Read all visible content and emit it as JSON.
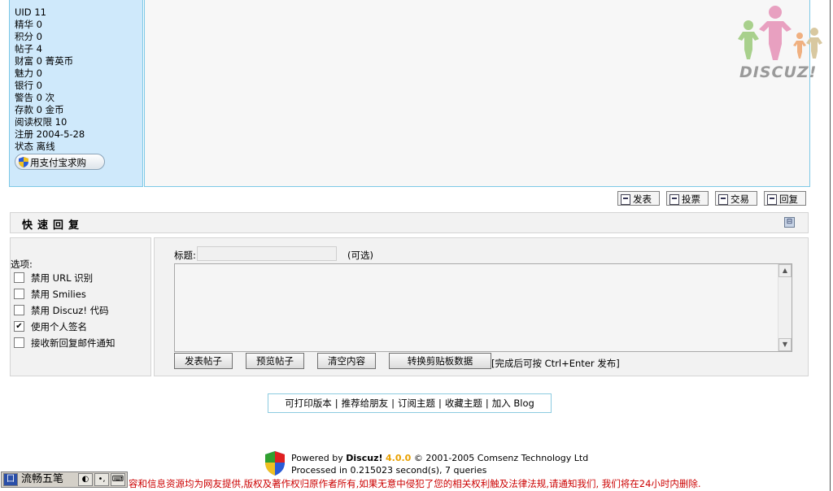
{
  "profile": {
    "lines": [
      "UID 11",
      "精华 0",
      "积分 0",
      "帖子 4",
      "财富 0 菁英币",
      "魅力 0",
      "银行 0",
      "警告 0 次",
      "存款 0 金币",
      "阅读权限 10",
      "注册 2004-5-28",
      "状态 离线"
    ],
    "alipay_button": "用支付宝求购"
  },
  "logo": {
    "text": "DISCUZ!"
  },
  "actions": {
    "post": "发表",
    "poll": "投票",
    "trade": "交易",
    "reply": "回复"
  },
  "quick_reply": {
    "title": "快速回复",
    "options_label": "选项:",
    "options": [
      {
        "label": "禁用 URL 识别",
        "checked": false
      },
      {
        "label": "禁用 Smilies",
        "checked": false
      },
      {
        "label": "禁用 Discuz! 代码",
        "checked": false
      },
      {
        "label": "使用个人签名",
        "checked": true
      },
      {
        "label": "接收新回复邮件通知",
        "checked": false
      }
    ],
    "subject_label": "标题:",
    "subject_value": "",
    "optional_note": "(可选)",
    "message_value": "",
    "buttons": {
      "submit": "发表帖子",
      "preview": "预览帖子",
      "clear": "清空内容",
      "clipboard": "转换剪贴板数据"
    },
    "hint": "[完成后可按 Ctrl+Enter 发布]"
  },
  "links": [
    "可打印版本",
    "推荐给朋友",
    "订阅主题",
    "收藏主题",
    "加入 Blog"
  ],
  "footer": {
    "powered_by": "Powered by",
    "brand": "Discuz!",
    "version": "4.0.0",
    "copyright": "© 2001-2005 Comsenz Technology Ltd",
    "processed": "Processed in 0.215023 second(s), 7 queries"
  },
  "notice": "容和信息资源均为网友提供,版权及著作权归原作者所有,如果无意中侵犯了您的相关权利触及法律法规,请通知我们, 我们将在24小时内删除.",
  "ime": {
    "name": "流畅五笔"
  },
  "colors": {
    "profile_bg": "#cfe9fb",
    "border_cyan": "#7ec9e6",
    "notice_red": "#cc0000",
    "version_orange": "#e8a000"
  }
}
